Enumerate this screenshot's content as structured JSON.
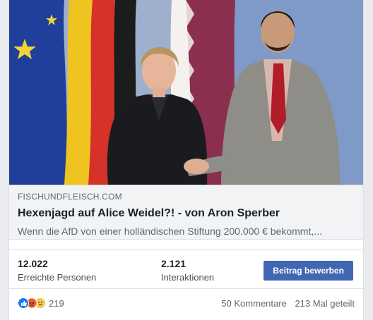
{
  "link_preview": {
    "domain": "FISCHUNDFLEISCH.COM",
    "headline": "Hexenjagd auf Alice Weidel?! - von Aron Sperber",
    "description": "Wenn die AfD von einer holländischen Stiftung 200.000 € bekommt,..."
  },
  "stats": {
    "reach": {
      "value": "12.022",
      "label": "Erreichte Personen"
    },
    "engagement": {
      "value": "2.121",
      "label": "Interaktionen"
    },
    "boost_label": "Beitrag bewerben"
  },
  "footer": {
    "reactions": [
      "like",
      "angry",
      "sad"
    ],
    "reaction_count": "219",
    "comments": "50 Kommentare",
    "shares": "213 Mal geteilt"
  },
  "colors": {
    "accent": "#4267b2",
    "link_box_bg": "#f2f3f5"
  }
}
